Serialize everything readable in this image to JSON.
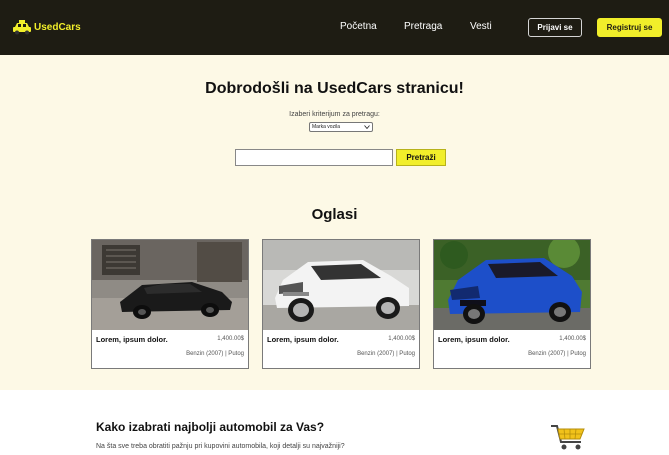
{
  "navbar": {
    "brand": "UsedCars",
    "links": [
      "Početna",
      "Pretraga",
      "Vesti"
    ],
    "login_label": "Prijavi se",
    "register_label": "Registruj se"
  },
  "hero": {
    "welcome": "Dobrodošli na UsedCars stranicu!",
    "criteria_label": "Izaberi kriterijum za pretragu:",
    "criteria_selected": "Marka vozila",
    "search_value": "",
    "search_button": "Pretraži"
  },
  "ads": {
    "title": "Oglasi",
    "cards": [
      {
        "title": "Lorem, ipsum dolor.",
        "price": "1,400.00$",
        "meta": "Benzin (2007) | Putog"
      },
      {
        "title": "Lorem, ipsum dolor.",
        "price": "1,400.00$",
        "meta": "Benzin (2007) | Putog"
      },
      {
        "title": "Lorem, ipsum dolor.",
        "price": "1,400.00$",
        "meta": "Benzin (2007) | Putog"
      }
    ]
  },
  "info": {
    "title": "Kako izabrati najbolji automobil za Vas?",
    "text": "Na šta sve treba obratiti pažnju pri kupovini automobila, koji detalji su najvažniji?"
  },
  "colors": {
    "navbar_bg": "#1e1c13",
    "accent_yellow": "#f1ee2a",
    "page_bg": "#fdf9e6"
  },
  "icons": [
    "taxi-logo-icon",
    "chevron-down-icon",
    "shopping-cart-icon"
  ]
}
